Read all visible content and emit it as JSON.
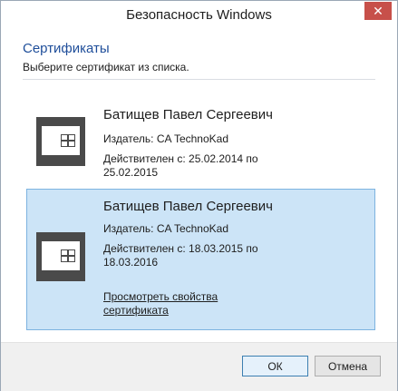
{
  "window": {
    "title": "Безопасность Windows",
    "close_glyph": "✕"
  },
  "header": {
    "heading": "Сертификаты",
    "subheading": "Выберите сертификат из списка."
  },
  "certificates": [
    {
      "icon": "certificate-card-icon",
      "name": "Батищев Павел Сергеевич",
      "issuer": "Издатель: CA TechnoKad",
      "validity": "Действителен с: 25.02.2014 по 25.02.2015",
      "selected": false
    },
    {
      "icon": "certificate-card-icon",
      "name": "Батищев Павел Сергеевич",
      "issuer": "Издатель: CA TechnoKad",
      "validity": "Действителен с: 18.03.2015 по 18.03.2016",
      "view_link": "Просмотреть свойства сертификата",
      "selected": true
    }
  ],
  "footer": {
    "ok_label": "ОК",
    "cancel_label": "Отмена"
  },
  "colors": {
    "heading": "#1f4e9a",
    "selection_bg": "#cce4f7",
    "selection_border": "#7db3e0",
    "close_button": "#c7504a"
  }
}
